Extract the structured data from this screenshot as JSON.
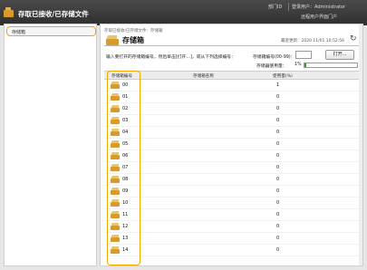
{
  "header": {
    "title": "存取已接收/已存储文件",
    "links": [
      "部门ID",
      "登录用户：Administrator"
    ],
    "sublink": "远程用户界面门户"
  },
  "sidebar": {
    "items": [
      {
        "label": "存储箱"
      }
    ]
  },
  "main": {
    "breadcrumb": "存取已接收/已存储文件：存储箱",
    "page_title": "存储箱",
    "last_updated": "最近更新：2020 11/01 10:52:56",
    "instruction": "输入要打开的存储箱编号，然后单击[打开…]，或从下列选择编号：",
    "box_number_label": "存储箱编号(00-99)：",
    "box_number_value": "",
    "open_button": "打开...",
    "usage_label": "存储器使用量：",
    "usage_value": "1%",
    "usage_fraction": 0.01,
    "colors": {
      "highlight": "#f0a800",
      "usage": "#3a9a3a",
      "box": "#d99a2a"
    }
  },
  "table": {
    "headers": [
      "存储箱编号",
      "存储箱名称",
      "使用量(%)"
    ],
    "rows": [
      {
        "num": "00",
        "name": "",
        "usage": "1"
      },
      {
        "num": "01",
        "name": "",
        "usage": "0"
      },
      {
        "num": "02",
        "name": "",
        "usage": "0"
      },
      {
        "num": "03",
        "name": "",
        "usage": "0"
      },
      {
        "num": "04",
        "name": "",
        "usage": "0"
      },
      {
        "num": "05",
        "name": "",
        "usage": "0"
      },
      {
        "num": "06",
        "name": "",
        "usage": "0"
      },
      {
        "num": "07",
        "name": "",
        "usage": "0"
      },
      {
        "num": "08",
        "name": "",
        "usage": "0"
      },
      {
        "num": "09",
        "name": "",
        "usage": "0"
      },
      {
        "num": "10",
        "name": "",
        "usage": "0"
      },
      {
        "num": "11",
        "name": "",
        "usage": "0"
      },
      {
        "num": "12",
        "name": "",
        "usage": "0"
      },
      {
        "num": "13",
        "name": "",
        "usage": "0"
      },
      {
        "num": "14",
        "name": "",
        "usage": "0"
      }
    ]
  },
  "icons": {
    "logo": "box-icon",
    "refresh": "refresh-icon",
    "row": "mailbox-icon"
  }
}
